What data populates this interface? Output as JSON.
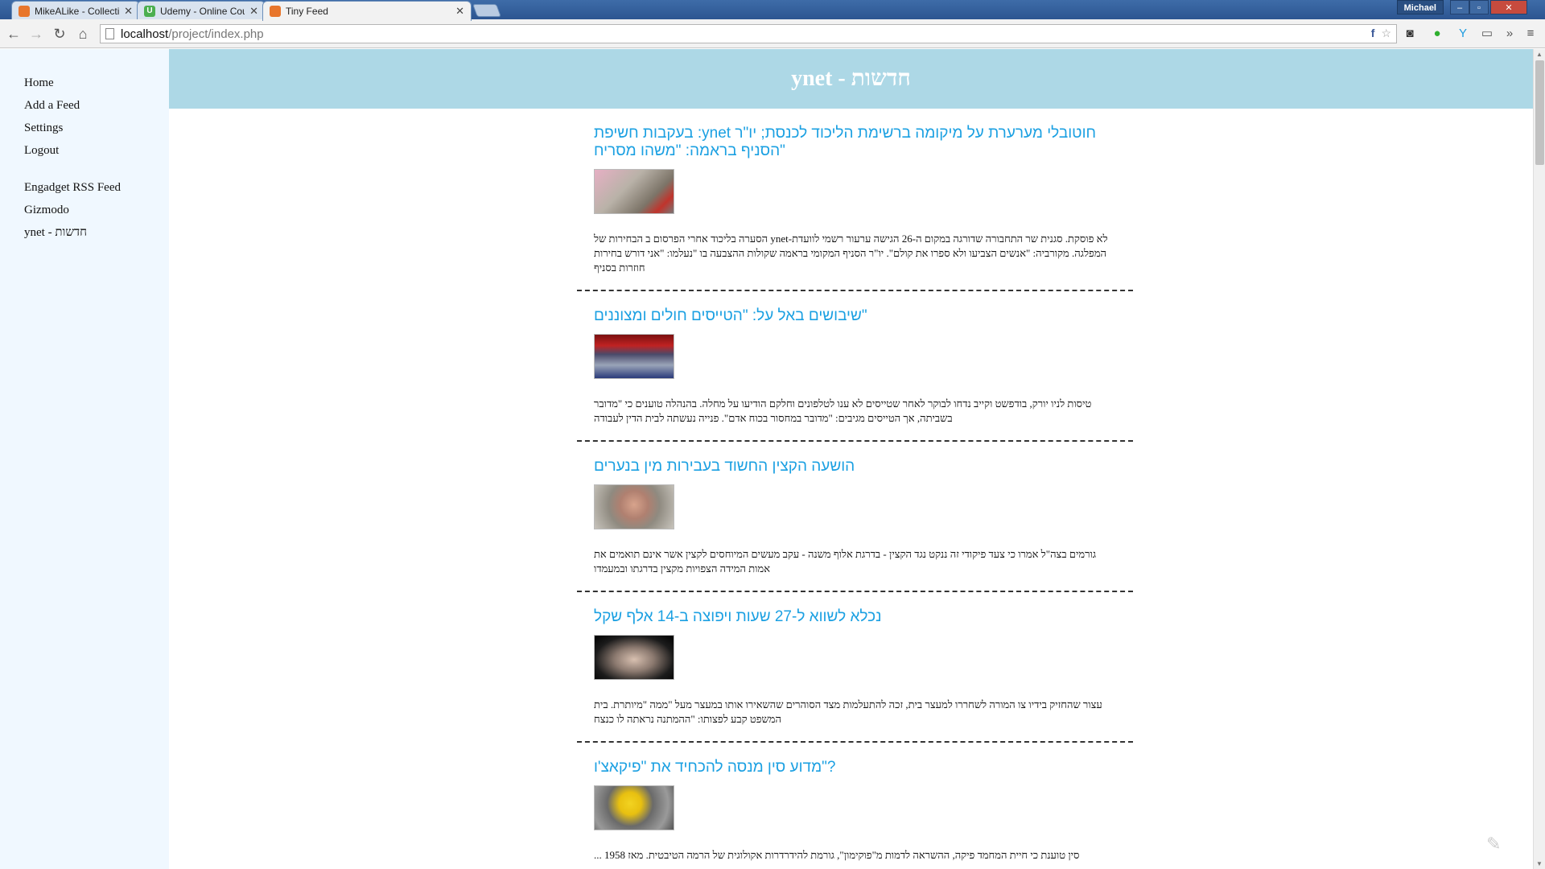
{
  "browser": {
    "tabs": [
      {
        "title": "MikeALike - Collection - G",
        "favicon_color": "#e8762c"
      },
      {
        "title": "Udemy - Online Courses f",
        "favicon_color": "#4caf50"
      },
      {
        "title": "Tiny Feed",
        "favicon_color": "#e8762c"
      }
    ],
    "user": "Michael",
    "url_host": "localhost",
    "url_path": "/project/index.php"
  },
  "sidebar": {
    "items": [
      "Home",
      "Add a Feed",
      "Settings",
      "Logout"
    ],
    "feeds": [
      "Engadget RSS Feed",
      "Gizmodo",
      "ynet - חדשות"
    ]
  },
  "header": {
    "title": "ynet - חדשות"
  },
  "articles": [
    {
      "title": "חוטובלי מערערת על מיקומה ברשימת הליכוד לכנסת; יו\"ר ynet: בעקבות חשיפת \"הסניף בראמה: \"משהו מסריח",
      "description": "לא פוסקת. סגנית שר התחבורה שדורגה במקום ה-26 הגישה ערעור רשמי לוועדת-ynet הסערה בליכוד אחרי הפרסום ב הבחירות של המפלגה. מקורביה: \"אנשים הצביעו ולא ספרו את קולם\". יו\"ר הסניף המקומי בראמה שקולות ההצבעה בו \"נעלמו: \"אני דורש בחירות חוזרות בסניף"
    },
    {
      "title": "\"שיבושים באל על: \"הטייסים חולים ומצוננים",
      "description": "טיסות לניו יורק, בודפשט וקייב נדחו לבוקר לאחר שטייסים לא ענו לטלפונים וחלקם הודיעו על מחלה. בהנהלה טוענים כי \"מדובר בשביתה, אך הטייסים מגיבים: \"מדובר במחסור בכוח אדם\". פנייה נעשתה לבית הדין לעבודה"
    },
    {
      "title": "הושעה הקצין החשוד בעבירות מין בנערים",
      "description": "גורמים בצה\"ל אמרו כי צעד פיקודי זה ננקט נגד הקצין - בדרגת אלוף משנה - עקב מעשים המיוחסים לקצין אשר אינם תואמים את אמות המידה הצפויות מקצין בדרגתו ובמעמדו"
    },
    {
      "title": "נכלא לשווא ל-27 שעות ויפוצה ב-14 אלף שקל",
      "description": "עצור שהחזיק בידיו צו המורה לשחררו למעצר בית, זכה להתעלמות מצד הסוהרים שהשאירו אותו במעצר מעל \"ממה \"מיותרת. בית המשפט קבע לפצותו: \"ההמתנה נראתה לו כנצח"
    },
    {
      "title": "?\"מדוע סין מנסה להכחיד את \"פיקאצ'ו",
      "description": "סין טוענת כי חיית המחמד פיקה, ההשראה לדמות מ\"פוקימון\", גורמת להידרדרות אקולוגית של הרמה הטיבטית. מאז 1958 ..."
    }
  ]
}
